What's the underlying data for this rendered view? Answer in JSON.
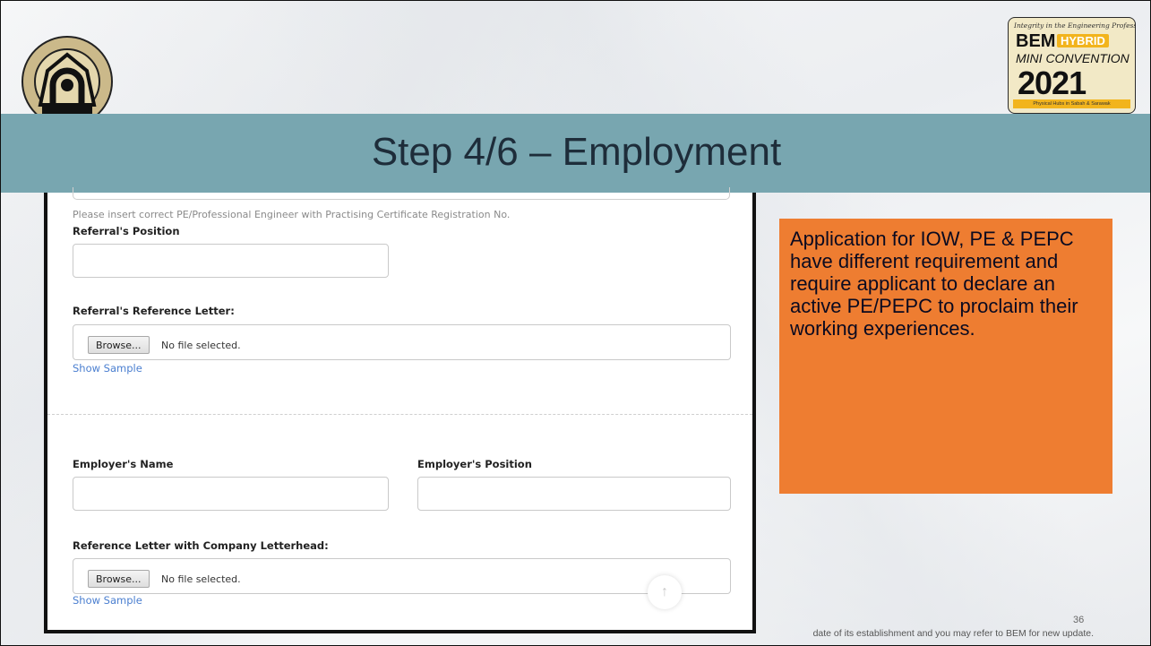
{
  "slide": {
    "title": "Step 4/6 – Employment",
    "page_number": "36",
    "footer_note": "date of its establishment and you may refer to BEM for new update."
  },
  "logo_right": {
    "tagline": "Integrity in the Engineering Profession",
    "brand": "BEM",
    "badge": "HYBRID",
    "subtitle": "MINI CONVENTION",
    "year": "2021",
    "strip": "Physical Hubs in Sabah & Sarawak"
  },
  "form": {
    "hint": "Please insert correct PE/Professional Engineer with Practising Certificate Registration No.",
    "referral_position_label": "Referral's Position",
    "referral_letter_label": "Referral's Reference Letter:",
    "browse_label": "Browse...",
    "no_file_text": "No file selected.",
    "show_sample": "Show Sample",
    "employer_name_label": "Employer's Name",
    "employer_position_label": "Employer's Position",
    "reference_letter_label": "Reference Letter with Company Letterhead:",
    "browse_label_2": "Browse...",
    "no_file_text_2": "No file selected.",
    "show_sample_2": "Show Sample",
    "scroll_top_icon": "↑"
  },
  "callout": {
    "text": "Application for IOW, PE & PEPC have different requirement and require applicant to declare an active PE/PEPC to proclaim their working experiences.",
    "color": "#ee7d31"
  },
  "colors": {
    "title_band": "#78a6b0",
    "link": "#4b7fd0"
  }
}
